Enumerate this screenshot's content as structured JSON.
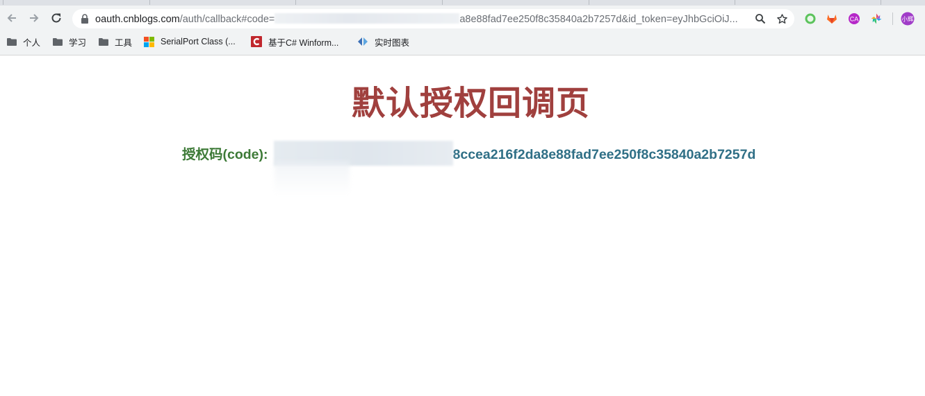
{
  "browser": {
    "url": {
      "host": "oauth.cnblogs.com",
      "path_prefix": "/auth/callback#code=",
      "path_suffix": "a8e88fad7ee250f8c35840a2b7257d&id_token=eyJhbGciOiJ..."
    },
    "icons": {
      "back": "back-arrow-icon",
      "forward": "forward-arrow-icon",
      "reload": "reload-icon",
      "lock": "lock-icon",
      "zoom": "magnifier-icon",
      "bookmark": "star-icon"
    },
    "extensions": [
      {
        "name": "green-ring-extension",
        "color": "#5cc35c"
      },
      {
        "name": "gitlab-extension",
        "color": "#e24329"
      },
      {
        "name": "ca-extension",
        "label": "CA",
        "color": "#b528c8"
      },
      {
        "name": "pinwheel-extension",
        "color": "#e84a5f"
      }
    ],
    "profile": {
      "label": "小辉",
      "color": "#a03cc8"
    },
    "bookmarks": [
      {
        "label": "个人",
        "icon": "folder-icon"
      },
      {
        "label": "学习",
        "icon": "folder-icon"
      },
      {
        "label": "工具",
        "icon": "folder-icon"
      },
      {
        "label": "SerialPort Class (...",
        "icon": "windows-logo-icon"
      },
      {
        "label": "基于C# Winform...",
        "icon": "cnblogs-c-icon"
      },
      {
        "label": "实时图表",
        "icon": "chart-logo-icon"
      }
    ]
  },
  "page": {
    "title": "默认授权回调页",
    "code_label": "授权码(code):",
    "code_value_visible": "8ccea216f2da8e88fad7ee250f8c35840a2b7257d",
    "colors": {
      "title": "#a0403e",
      "label": "#3d7a37",
      "value": "#2f6f86"
    }
  }
}
